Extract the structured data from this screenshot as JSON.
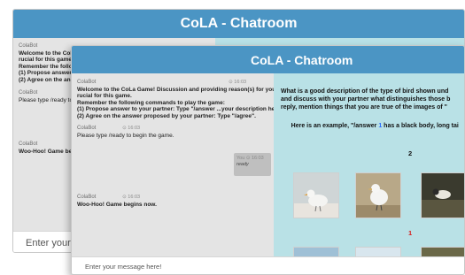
{
  "back_window": {
    "title": "CoLA - Chatroom",
    "messages": [
      {
        "sender": "ColaBot",
        "text": "Welcome to the CoLa G\nrucial for this game.\nRemember the followin\n(1) Propose answer to y\n(2) Agree on the answe"
      },
      {
        "sender": "ColaBot",
        "text": "Please type /ready to be"
      },
      {
        "sender": "ColaBot",
        "text": "Woo-Hoo! Game begins"
      }
    ],
    "input_placeholder": "Enter your message here!"
  },
  "front_window": {
    "title": "CoLA - Chatroom",
    "messages": [
      {
        "sender": "ColaBot",
        "time": "⊙ 16:03",
        "text": "Welcome to the CoLa Game! Discussion and providing reason(s) for your answer is c\nrucial for this game.\nRemember the following commands to play the game:\n(1) Propose answer to your partner: Type \"/answer ...your description here...\".\n(2) Agree on the answer proposed by your partner: Type \"/agree\"."
      },
      {
        "sender": "ColaBot",
        "time": "⊙ 16:03",
        "text": "Please type /ready to begin the game."
      },
      {
        "sender": "ColaBot",
        "time": "⊙ 16:03",
        "text": "Woo-Hoo! Game begins now."
      }
    ],
    "user_message": {
      "sender": "You",
      "time": "⊙ 16:03",
      "text": "ready"
    },
    "question": "What is a good description of the type of bird shown und\nand discuss with your partner what distinguishes those b\nreply, mention things that you are true of the images of \"",
    "example_prefix": "Here is an example, \"/answer ",
    "example_number": "1",
    "example_suffix": " has a black body, long tai",
    "group_labels": [
      "2",
      "1"
    ],
    "input_placeholder": "Enter your message here!"
  },
  "colors": {
    "header_blue": "#4b95c4",
    "chat_gray": "#e4e4e4",
    "panel_teal": "#b9e1e6",
    "label_red": "#d62020",
    "label_blue": "#2b6cff"
  }
}
